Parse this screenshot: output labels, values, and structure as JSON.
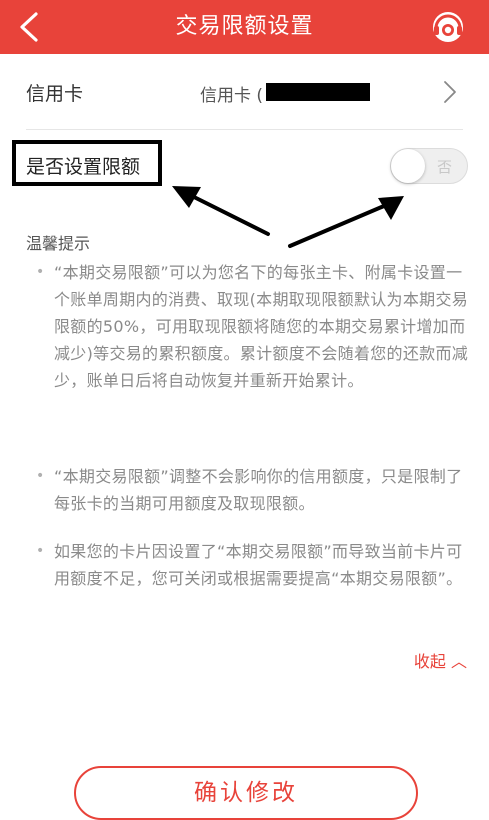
{
  "colors": {
    "brand": "#e8433a",
    "toggle_off": "#efefef",
    "tip_text": "#8a8a8a"
  },
  "header": {
    "title": "交易限额设置",
    "back_icon": "chevron-left-icon",
    "service_icon": "customer-service-icon"
  },
  "card_row": {
    "label": "信用卡",
    "value_prefix": "信用卡 (",
    "chevron_icon": "chevron-right-icon"
  },
  "limit_setting": {
    "label": "是否设置限额",
    "toggle_state_text": "否"
  },
  "tips": {
    "title": "温馨提示",
    "bullet": "•",
    "items": [
      "“本期交易限额”可以为您名下的每张主卡、附属卡设置一个账单周期内的消费、取现(本期取现限额默认为本期交易限额的50%，可用取现限额将随您的本期交易累计增加而减少)等交易的累积额度。累计额度不会随着您的还款而减少，账单日后将自动恢复并重新开始累计。",
      "“本期交易限额”调整不会影响你的信用额度，只是限制了每张卡的当期可用额度及取现限额。",
      "如果您的卡片因设置了“本期交易限额”而导致当前卡片可用额度不足，您可关闭或根据需要提高“本期交易限额”。"
    ],
    "collapse_label": "收起 ︿"
  },
  "confirm_button": {
    "label": "确认修改"
  }
}
